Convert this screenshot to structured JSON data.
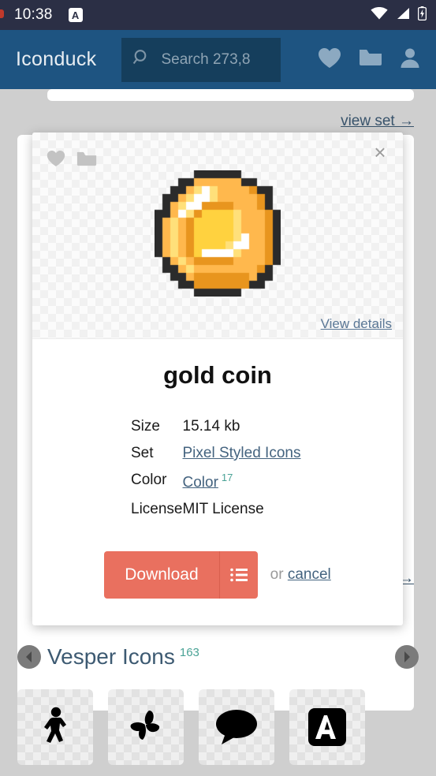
{
  "status_bar": {
    "time": "10:38",
    "notification_icon": "letter-a-badge-icon",
    "icons": [
      "wifi-icon",
      "cellular-signal-icon",
      "battery-charging-icon"
    ]
  },
  "header": {
    "brand": "Iconduck",
    "search": {
      "placeholder": "Search 273,8",
      "icon": "search-icon",
      "value": ""
    },
    "actions": [
      {
        "name": "favorites-icon",
        "label": "Favorites"
      },
      {
        "name": "collections-folder-icon",
        "label": "Collections"
      },
      {
        "name": "user-account-icon",
        "label": "Account"
      }
    ]
  },
  "page": {
    "view_set_label": "view set →",
    "view_set_label_2": "→"
  },
  "set_strip": {
    "prev_label": "‹",
    "next_label": "›",
    "title": "Vesper Icons",
    "count": "163",
    "icons": [
      {
        "name": "walking-person-icon",
        "label": "walk"
      },
      {
        "name": "butterfly-icon",
        "label": "butterfly"
      },
      {
        "name": "speech-bubble-icon",
        "label": "comment"
      },
      {
        "name": "letter-a-square-icon",
        "label": "letter a"
      }
    ]
  },
  "modal": {
    "close_label": "×",
    "tools": [
      {
        "name": "favorite-heart-icon",
        "label": "Favorite"
      },
      {
        "name": "add-to-collection-folder-icon",
        "label": "Add to collection"
      }
    ],
    "preview_icon_name": "gold-coin-pixel-icon",
    "view_details_label": "View details",
    "title": "gold coin",
    "specs": [
      {
        "key": "Size",
        "value": "15.14 kb",
        "link": false,
        "sup": ""
      },
      {
        "key": "Set",
        "value": "Pixel Styled Icons",
        "link": true,
        "sup": ""
      },
      {
        "key": "Color",
        "value": "Color",
        "link": true,
        "sup": "17"
      },
      {
        "key": "License",
        "value": "MIT License",
        "link": false,
        "sup": ""
      }
    ],
    "download_label": "Download",
    "download_menu_icon": "list-options-icon",
    "or_text": "or",
    "cancel_label": "cancel"
  },
  "colors": {
    "status_bar_bg": "#2b2f45",
    "app_bar_bg": "#1e5481",
    "search_bg": "#153e5c",
    "page_bg": "#cfcfcf",
    "accent_download": "#e9705f",
    "link": "#44637f",
    "teal_count": "#4aa396",
    "set_title": "#3d5a72"
  },
  "coin_pixels": {
    "cell": 10,
    "cols": 16,
    "rows": 16,
    "palette": {
      "k": "#2b2b2b",
      "o": "#e8951e",
      "y": "#ffd23f",
      "l": "#ffe07a",
      "a": "#ffb84d",
      "w": "#ffffff",
      "-": "transparent"
    },
    "rows_data": [
      "-----kkkkkk-----",
      "---kkaaaaaakk---",
      "--kkalwlaaaaokk-",
      "-kkalwwlaaaaaok-",
      "-kalwwooooaaaok-",
      "kkawloyyyylaaaok",
      "kalaoyyyyylaaaok",
      "kalaoyyyyylaaaok",
      "kalaoyyyyylwaaok",
      "kalaoyyyylwwaaok",
      "kalaoywwwwlaaaok",
      "-kalaoooooaaaaok",
      "-kkalaaaaaaaaok-",
      "--kkaoooooooakk-",
      "---kkoooooookk--",
      "-----kkkkkk-----"
    ]
  }
}
